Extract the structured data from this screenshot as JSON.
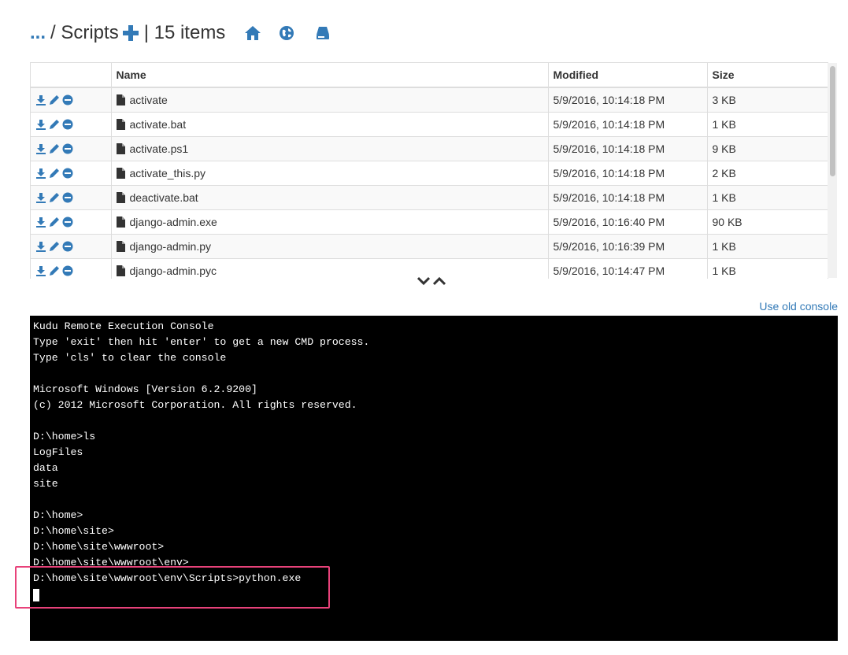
{
  "header": {
    "parent_link": "...",
    "separator_title": " / Scripts",
    "item_count": "| 15 items"
  },
  "table": {
    "columns": [
      "",
      "Name",
      "Modified",
      "Size"
    ],
    "rows": [
      {
        "name": "activate",
        "modified": "5/9/2016, 10:14:18 PM",
        "size": "3 KB"
      },
      {
        "name": "activate.bat",
        "modified": "5/9/2016, 10:14:18 PM",
        "size": "1 KB"
      },
      {
        "name": "activate.ps1",
        "modified": "5/9/2016, 10:14:18 PM",
        "size": "9 KB"
      },
      {
        "name": "activate_this.py",
        "modified": "5/9/2016, 10:14:18 PM",
        "size": "2 KB"
      },
      {
        "name": "deactivate.bat",
        "modified": "5/9/2016, 10:14:18 PM",
        "size": "1 KB"
      },
      {
        "name": "django-admin.exe",
        "modified": "5/9/2016, 10:16:40 PM",
        "size": "90 KB"
      },
      {
        "name": "django-admin.py",
        "modified": "5/9/2016, 10:16:39 PM",
        "size": "1 KB"
      },
      {
        "name": "django-admin.pyc",
        "modified": "5/9/2016, 10:14:47 PM",
        "size": "1 KB"
      }
    ]
  },
  "old_console_link": "Use old console",
  "console": {
    "lines": [
      "Kudu Remote Execution Console",
      "Type 'exit' then hit 'enter' to get a new CMD process.",
      "Type 'cls' to clear the console",
      "",
      "Microsoft Windows [Version 6.2.9200]",
      "(c) 2012 Microsoft Corporation. All rights reserved.",
      "",
      "D:\\home>ls",
      "LogFiles",
      "data",
      "site",
      "",
      "D:\\home>",
      "D:\\home\\site>",
      "D:\\home\\site\\wwwroot>",
      "D:\\home\\site\\wwwroot\\env>",
      "D:\\home\\site\\wwwroot\\env\\Scripts>python.exe"
    ]
  },
  "colors": {
    "accent": "#337ab7",
    "highlight": "#e8427a",
    "console_bg": "#000000"
  },
  "icons": {
    "header": [
      "plus-icon",
      "home-icon",
      "globe-icon",
      "drive-icon"
    ],
    "row_actions": [
      "download-icon",
      "edit-icon",
      "delete-icon"
    ],
    "file": "file-icon",
    "resizer": [
      "chevron-down-icon",
      "chevron-up-icon"
    ]
  }
}
